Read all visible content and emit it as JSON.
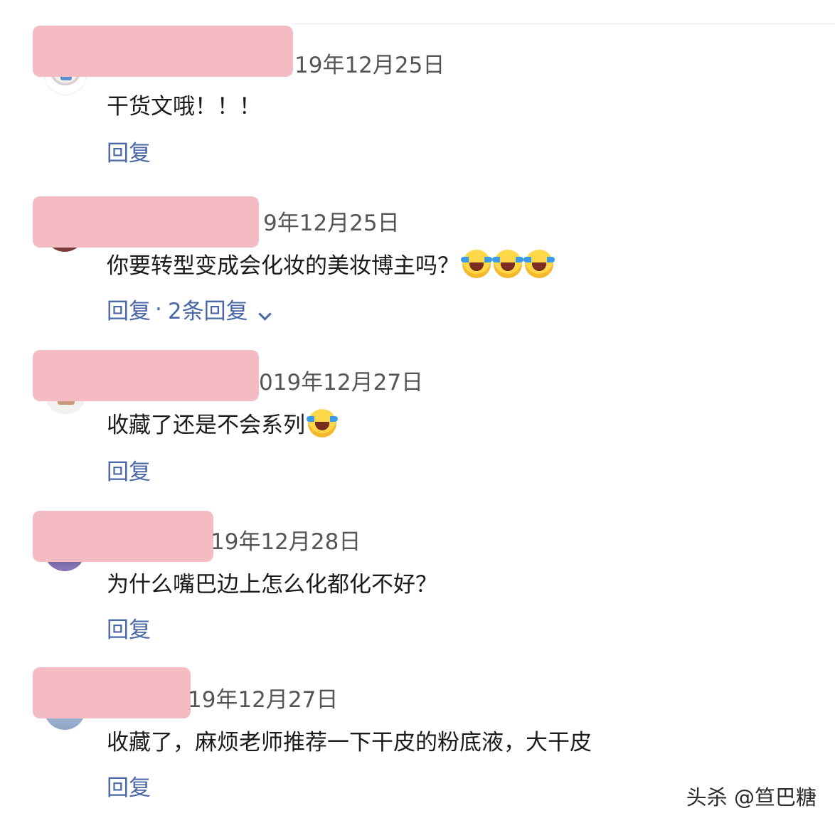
{
  "comments": [
    {
      "date": "19年12月25日",
      "text": "干货文哦！！！",
      "reply_label": "回复"
    },
    {
      "date": "9年12月25日",
      "text": "你要转型变成会化妆的美妆博主吗？",
      "emoji_icon": "crying-laughing-emoji-icon",
      "reply_label": "回复",
      "separator": "·",
      "sub_replies_label": "2条回复"
    },
    {
      "date": "019年12月27日",
      "text": "收藏了还是不会系列",
      "emoji_icon": "crying-laughing-emoji-icon",
      "reply_label": "回复"
    },
    {
      "date": "19年12月28日",
      "text": "为什么嘴巴边上怎么化都化不好？",
      "reply_label": "回复"
    },
    {
      "date": "19年12月27日",
      "text": "收藏了，麻烦老师推荐一下干皮的粉底液，大干皮",
      "reply_label": "回复"
    }
  ],
  "watermark": "头杀 @笪巴糖",
  "colors": {
    "link": "#4a67a8",
    "name_mask": "#f4bcc2",
    "text": "#1a1a1a",
    "date": "#555555"
  }
}
